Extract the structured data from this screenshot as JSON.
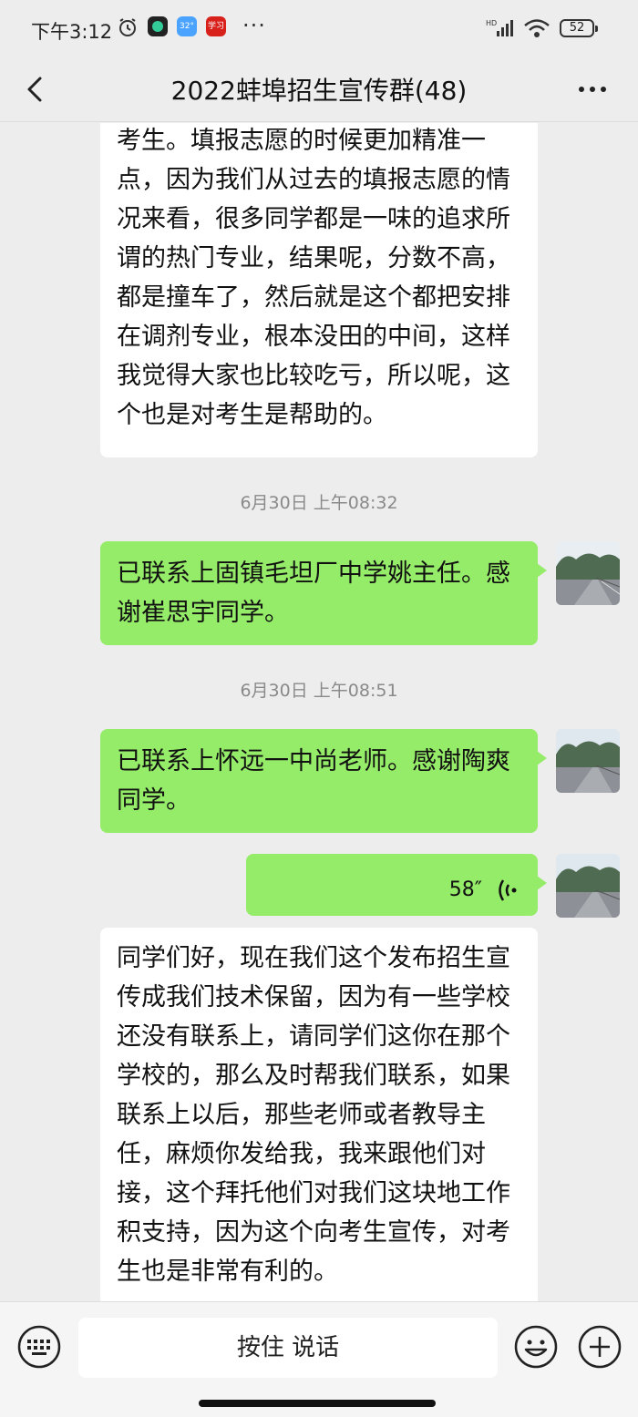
{
  "status_bar": {
    "time": "下午3:12",
    "app2_label": "32°",
    "app3_label": "学习",
    "more": "···",
    "battery": "52"
  },
  "header": {
    "title": "2022蚌埠招生宣传群(48)"
  },
  "messages": [
    {
      "type": "received_text",
      "text": "考生。填报志愿的时候更加精准一点，因为我们从过去的填报志愿的情况来看，很多同学都是一味的追求所谓的热门专业，结果呢，分数不高，都是撞车了，然后就是这个都把安排在调剂专业，根本没田的中间，这样我觉得大家也比较吃亏，所以呢，这个也是对考生是帮助的。"
    },
    {
      "type": "timestamp",
      "text": "6月30日 上午08:32"
    },
    {
      "type": "sent_text",
      "text": "已联系上固镇毛坦厂中学姚主任。感谢崔思宇同学。"
    },
    {
      "type": "timestamp",
      "text": "6月30日 上午08:51"
    },
    {
      "type": "sent_text",
      "text": "已联系上怀远一中尚老师。感谢陶爽同学。"
    },
    {
      "type": "sent_voice",
      "duration": "58″"
    },
    {
      "type": "received_text",
      "text": "同学们好，现在我们这个发布招生宣传成我们技术保留，因为有一些学校还没有联系上，请同学们这你在那个学校的，那么及时帮我们联系，如果联系上以后，那些老师或者教导主任，麻烦你发给我，我来跟他们对接，这个拜托他们对我们这块地工作积支持，因为这个向考生宣传，对考生也是非常有利的。"
    }
  ],
  "bottom_bar": {
    "hold_to_talk": "按住 说话"
  }
}
